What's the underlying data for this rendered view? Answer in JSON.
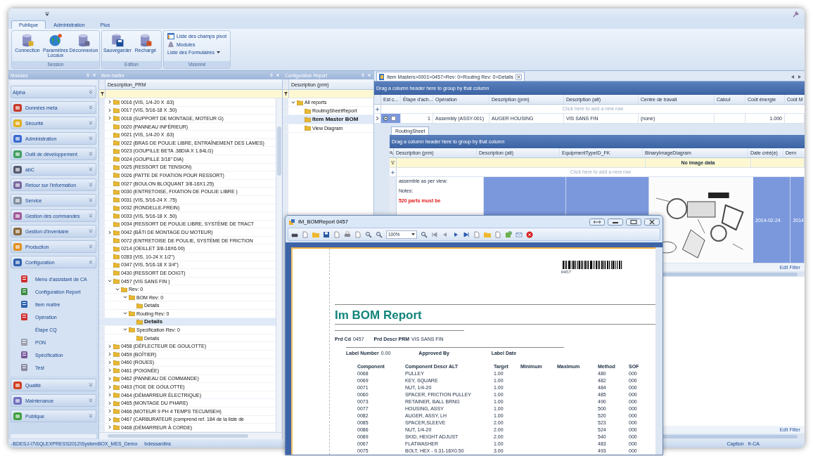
{
  "ribbon": {
    "tabs": [
      {
        "label": "Publique",
        "selected": true
      },
      {
        "label": "Administration",
        "selected": false
      },
      {
        "label": "Plus",
        "selected": false
      }
    ],
    "groups": [
      {
        "label": "Session",
        "items": [
          {
            "kind": "large",
            "label": "Connection"
          },
          {
            "kind": "large",
            "label": "Paramètres Locaux"
          },
          {
            "kind": "large",
            "label": "Déconnexion"
          }
        ]
      },
      {
        "label": "Edition",
        "items": [
          {
            "kind": "large",
            "label": "Sauvegarder"
          },
          {
            "kind": "large",
            "label": "Rechargé"
          }
        ]
      },
      {
        "label": "Visionné",
        "items": [
          {
            "kind": "small",
            "label": "Liste des champs pivot"
          },
          {
            "kind": "small",
            "label": "Modules"
          },
          {
            "kind": "dropdown",
            "label": "Liste des Formulaires"
          }
        ]
      }
    ]
  },
  "modules_pane": {
    "title": "Modules",
    "groups": [
      {
        "label": "Alpha",
        "expanded": false
      },
      {
        "label": "Données meta",
        "expanded": false
      },
      {
        "label": "Sécurité",
        "expanded": false
      },
      {
        "label": "Administration",
        "expanded": false
      },
      {
        "label": "Outil de développement",
        "expanded": false
      },
      {
        "label": "abC",
        "expanded": false
      },
      {
        "label": "Retour sur l'information",
        "expanded": false
      },
      {
        "label": "Service",
        "expanded": false
      },
      {
        "label": "Gestion des commandes",
        "expanded": false
      },
      {
        "label": "Gestion d'inventaire",
        "expanded": false
      },
      {
        "label": "Production",
        "expanded": false
      },
      {
        "label": "Configuration",
        "expanded": true,
        "items": [
          "Menu d'assistant de CA",
          "Configuration Report",
          "Item maître",
          "Opération",
          "Étape CQ",
          "PON",
          "Spécification",
          "Test"
        ]
      },
      {
        "label": "Qualité",
        "expanded": false
      },
      {
        "label": "Maintenance",
        "expanded": false
      },
      {
        "label": "Publique",
        "expanded": false
      }
    ]
  },
  "item_pane": {
    "title": "Item maître",
    "column": "Description_PRM",
    "nodes": [
      {
        "label": "0016 (VIS, 1/4-20 X .63)",
        "expanded": false,
        "selected": false
      },
      {
        "label": "0017 (VIS, 5/16-18 X .50)",
        "expanded": false,
        "selected": false
      },
      {
        "label": "0018 (SUPPORT DE MONTAGE, MOTEUR G)",
        "expanded": false,
        "selected": false
      },
      {
        "label": "0020 (PANNEAU INFÉRIEUR)",
        "selected": false
      },
      {
        "label": "0021 (VIS, 1/4-20 X .63)",
        "selected": false
      },
      {
        "label": "0022 (BRAS DE POULIE LIBRE, ENTRAÎNEMENT DES LAMES)",
        "selected": false
      },
      {
        "label": "0023 (GOUPILLE BETA .38DIA X 1.64LG)",
        "selected": false
      },
      {
        "label": "0024 (GOUPILLE 3/16\" DIA)",
        "selected": false
      },
      {
        "label": "0025 (RESSORT DE TENSION)",
        "selected": false
      },
      {
        "label": "0026 (PATTE DE FIXATION POUR RESSORT)",
        "selected": false
      },
      {
        "label": "0027 (BOULON BLOQUANT 3/8-16X1.25)",
        "selected": false
      },
      {
        "label": "0030 (ENTRETOISE, FIXATION DE POULIE LIBRE )",
        "selected": false
      },
      {
        "label": "0031 (VIS, 5/16-24 X .75)",
        "selected": false
      },
      {
        "label": "0032 (RONDELLE-FREIN)",
        "selected": false
      },
      {
        "label": "0033 (VIS, 5/16-18 X .50)",
        "selected": false
      },
      {
        "label": "0034 (RESSORT DE POULIE LIBRE, SYSTÈME DE TRACT",
        "selected": false
      },
      {
        "label": "0042 (BÂTI DE MONTAGE DU MOTEUR)",
        "expanded": false,
        "selected": false
      },
      {
        "label": "0072 (ENTRETOISE DE POULIE, SYSTÈME DE FRICTION",
        "selected": false
      },
      {
        "label": "0214 (OEILLET 3/8-16X6.00)",
        "selected": false
      },
      {
        "label": "0283 (VIS, 10-24 X 1/2\")",
        "selected": false
      },
      {
        "label": "0347 (VIS, 5/16-18 X 3/4\")",
        "selected": false
      },
      {
        "label": "0430 (RESSORT DE DOIGT)",
        "selected": false
      },
      {
        "label": "0457 (VIS SANS FIN )",
        "expanded": true,
        "selected": false,
        "children": [
          {
            "label": "Rev: 0",
            "expanded": true,
            "selected": false,
            "children": [
              {
                "label": "BOM Rev: 0",
                "expanded": true,
                "selected": false,
                "children": [
                  {
                    "label": "Details",
                    "selected": false
                  }
                ]
              },
              {
                "label": "Routing Rev: 0",
                "expanded": true,
                "selected": false,
                "children": [
                  {
                    "label": "Details",
                    "selected": true
                  }
                ]
              },
              {
                "label": "Specification Rev: 0",
                "expanded": true,
                "selected": false,
                "children": [
                  {
                    "label": "Details",
                    "selected": false
                  }
                ]
              }
            ]
          }
        ]
      },
      {
        "label": "0458 (DÉFLECTEUR DE GOULOTTE)",
        "expanded": false,
        "selected": false
      },
      {
        "label": "0459 (BOÎTIER)",
        "expanded": false,
        "selected": false
      },
      {
        "label": "0460 (ROUES)",
        "expanded": false,
        "selected": false
      },
      {
        "label": "0461 (POIGNÉE)",
        "expanded": false,
        "selected": false
      },
      {
        "label": "0462 (PANNEAU DE COMMANDE)",
        "expanded": false,
        "selected": false
      },
      {
        "label": "0463 (TIGE DE GOULOTTE)",
        "expanded": false,
        "selected": false
      },
      {
        "label": "0464 (DÉMARREUR ÉLECTRIQUE)",
        "expanded": false,
        "selected": false
      },
      {
        "label": "0465 (MONTAGE DU PHARE)",
        "expanded": false,
        "selected": false
      },
      {
        "label": "0466 (MOTEUR 9 PH 4 TEMPS TECUMSEH)",
        "expanded": false,
        "selected": false
      },
      {
        "label": "0467 (CARBURATEUR (comprend ref. 184 de la liste de",
        "expanded": false,
        "selected": false
      },
      {
        "label": "0468 (DÉMARREUR À CORDE)",
        "expanded": false,
        "selected": false
      }
    ]
  },
  "config_report_pane": {
    "title": "Configuration Report",
    "column": "Description (prm)",
    "nodes": [
      {
        "label": "All reports",
        "expanded": true,
        "selected": false,
        "children": [
          {
            "label": "RoutingSheetReport",
            "selected": false
          },
          {
            "label": "Item Master BOM",
            "selected": true
          },
          {
            "label": "View Diagram",
            "selected": false
          }
        ]
      }
    ]
  },
  "details_pane": {
    "tab": "Item Masters>0001>0457>Rev: 0>Routing Rev: 0>Details",
    "group_hint": "Drag a column header here to group by that column",
    "columns": [
      "Est c...",
      "Étape d'ach...",
      "Opération",
      "Description (prm)",
      "Description (alt)",
      "Centre de travail",
      "Calcul",
      "Coût énergie",
      "Coût M"
    ],
    "new_row": "Click here to add a new row",
    "rows": [
      {
        "checked": false,
        "expanded": true,
        "cells": [
          "",
          "1",
          "Assembly (ASSY-001)",
          "AUGER HOUSING",
          "VIS SANS FIN",
          "(none)",
          "",
          "1.000"
        ]
      }
    ],
    "detail": {
      "tab": {
        "label": "RoutingSheet",
        "selected": true
      },
      "group_hint": "Drag a column header here to group by that column",
      "columns": [
        "Description (prm)",
        "Description (alt)",
        "EquipmentTypeID_FK",
        "BinaryImageDiagram",
        "Date créé(e)",
        "Dern"
      ],
      "filter_text": "No image data",
      "new_row": "Click here to add a new row",
      "row": {
        "selected": true,
        "notes": [
          "assemble as per view:",
          "Notes:"
        ],
        "warning": "520 parts must be",
        "picture": {
          "kind": "picture"
        },
        "date": "2014-02-24",
        "column_6": "2014"
      },
      "edit_filter": "Edit Filter"
    },
    "edit_filter": "Edit Filter"
  },
  "status_bar": {
    "connection": "-BDESJ-I7\\SQLEXPRESS2012\\SystemBOX_MES_Demo",
    "user": "bdessardins",
    "caption_label": "Caption",
    "culture": "fr-CA"
  },
  "report_window": {
    "title": "IM_BOMReport 0457",
    "zoom": "100%",
    "barcode_text": "0457",
    "report_title": "Im BOM Report",
    "fields": [
      {
        "label": "Prd Cd",
        "value": "0457"
      },
      {
        "label": "Prd Descr PRM",
        "value": "VIS SANS FIN"
      }
    ],
    "label_fields": [
      {
        "label": "Label Number",
        "value": "0.00"
      },
      {
        "label": "Approved By"
      },
      {
        "label": "Label Date"
      }
    ],
    "columns": [
      "Component",
      "Component Descr ALT",
      "Target",
      "Minimum",
      "Maximum",
      "Method",
      "SOF"
    ],
    "rows": [
      {
        "component": "0068",
        "descr": "PULLEY",
        "target": "1.00",
        "method": "480",
        "sof": "000"
      },
      {
        "component": "0069",
        "descr": "KEY, SQUARE",
        "target": "1.00",
        "method": "482",
        "sof": "000"
      },
      {
        "component": "0071",
        "descr": "NUT, 1/4-20",
        "target": "1.00",
        "method": "484",
        "sof": "000"
      },
      {
        "component": "0060",
        "descr": "SPACER, FRICTION PULLEY",
        "target": "1.00",
        "method": "485",
        "sof": "000"
      },
      {
        "component": "0073",
        "descr": "RETAINER, BALL BRNG",
        "target": "1.00",
        "method": "490",
        "sof": "000"
      },
      {
        "component": "0077",
        "descr": "HOUSING, ASSY",
        "target": "1.00",
        "method": "500",
        "sof": "000"
      },
      {
        "component": "0082",
        "descr": "AUGER, ASSY, LH",
        "target": "1.00",
        "method": "520",
        "sof": "000"
      },
      {
        "component": "0085",
        "descr": "SPACER,SLEEVE",
        "target": "2.00",
        "method": "523",
        "sof": "000"
      },
      {
        "component": "0086",
        "descr": "NUT, 1/4-20",
        "target": "2.00",
        "method": "524",
        "sof": "000"
      },
      {
        "component": "0089",
        "descr": "SKID, HEIGHT ADJUST",
        "target": "2.00",
        "method": "540",
        "sof": "000"
      },
      {
        "component": "0067",
        "descr": "FLATWASHER",
        "target": "1.00",
        "method": "483",
        "sof": "000"
      },
      {
        "component": "0075",
        "descr": "BOLT, HEX - 0.31-18X0.50",
        "target": "3.00",
        "method": "493",
        "sof": "000"
      }
    ]
  }
}
